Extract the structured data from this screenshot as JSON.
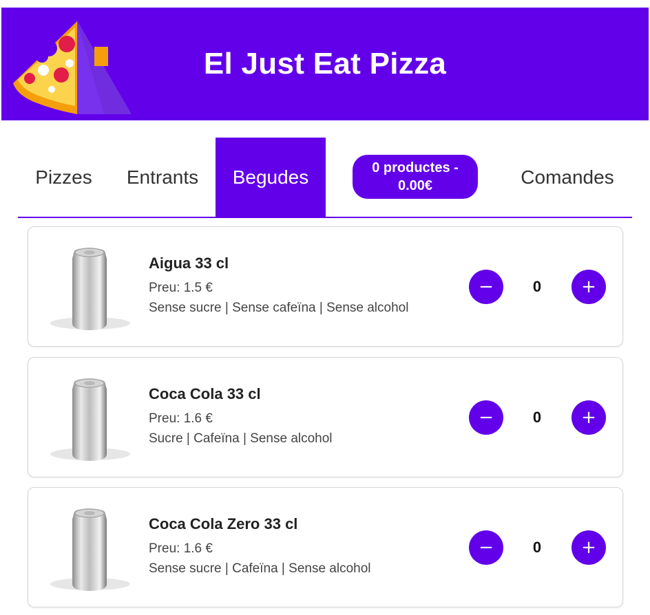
{
  "header": {
    "title": "El Just Eat Pizza",
    "logo_icon": "pizza-slice-icon"
  },
  "nav": {
    "tabs": [
      {
        "label": "Pizzes",
        "active": false
      },
      {
        "label": "Entrants",
        "active": false
      },
      {
        "label": "Begudes",
        "active": true
      },
      {
        "label": "Comandes",
        "active": false
      }
    ],
    "cart": {
      "line1": "0 productes -",
      "line2": "0.00€"
    }
  },
  "products": [
    {
      "name": "Aigua 33 cl",
      "price": "Preu: 1.5 €",
      "tags": "Sense sucre | Sense cafeïna | Sense alcohol",
      "qty": "0",
      "image": "can-icon"
    },
    {
      "name": "Coca Cola 33 cl",
      "price": "Preu: 1.6 €",
      "tags": "Sucre | Cafeïna | Sense alcohol",
      "qty": "0",
      "image": "can-icon"
    },
    {
      "name": "Coca Cola Zero 33 cl",
      "price": "Preu: 1.6 €",
      "tags": "Sense sucre | Cafeïna | Sense alcohol",
      "qty": "0",
      "image": "can-icon"
    }
  ],
  "controls": {
    "minus_symbol": "−",
    "plus_symbol": "+"
  },
  "colors": {
    "accent": "#6200ea",
    "text": "#333333",
    "card_border": "#d6d6d6"
  }
}
